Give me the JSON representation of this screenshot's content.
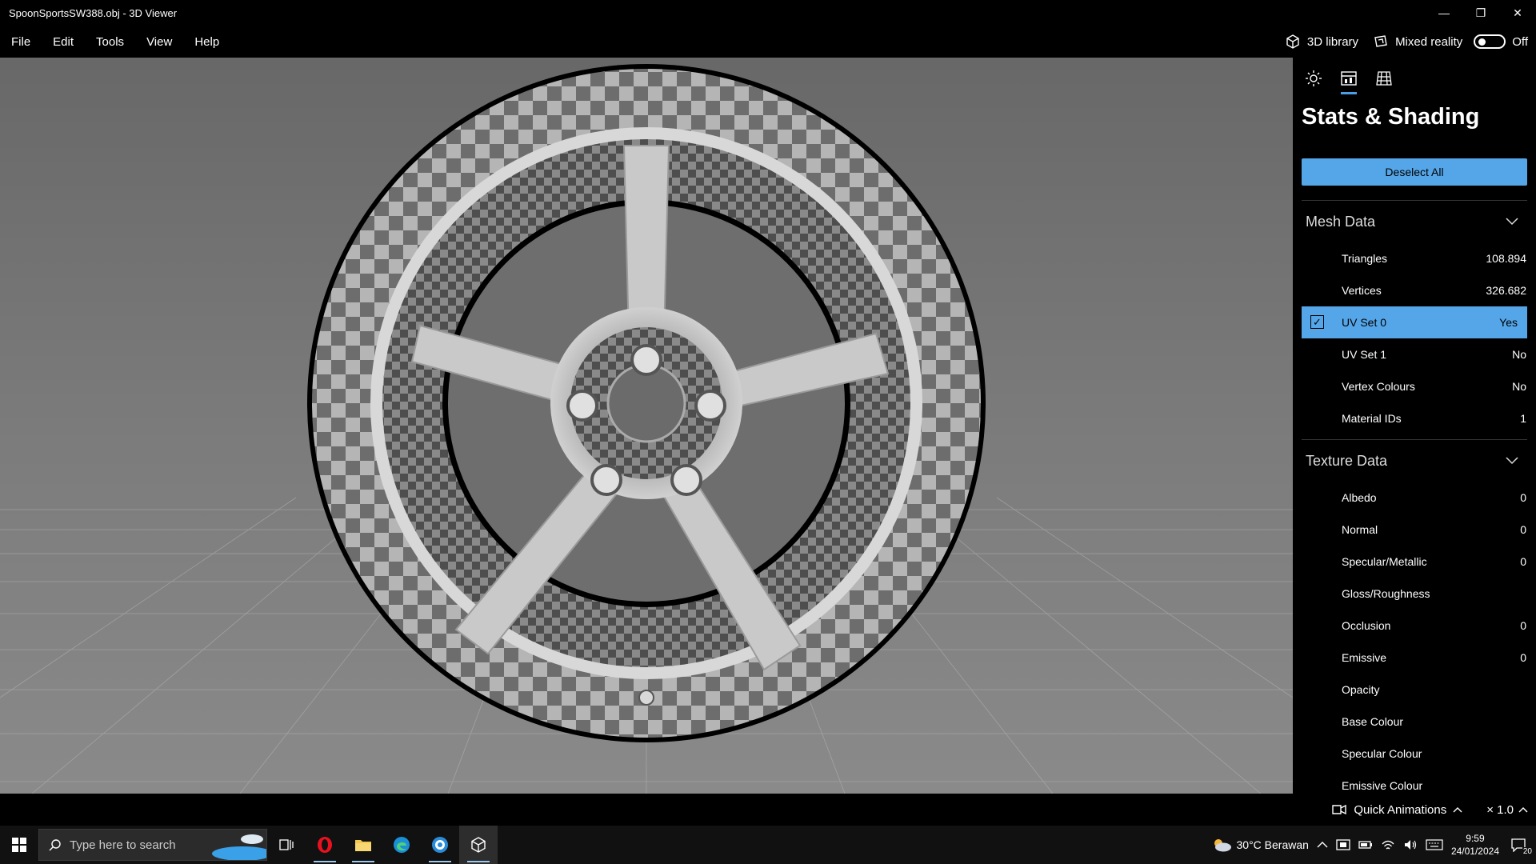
{
  "window": {
    "title": "SpoonSportsSW388.obj - 3D Viewer"
  },
  "menu": {
    "items": [
      "File",
      "Edit",
      "Tools",
      "View",
      "Help"
    ],
    "library_label": "3D library",
    "mixed_reality_label": "Mixed reality",
    "mixed_reality_state": "Off"
  },
  "panel": {
    "title": "Stats & Shading",
    "deselect_label": "Deselect All",
    "mesh_section": "Mesh Data",
    "mesh_rows": [
      {
        "label": "Triangles",
        "value": "108.894"
      },
      {
        "label": "Vertices",
        "value": "326.682"
      },
      {
        "label": "UV Set 0",
        "value": "Yes"
      },
      {
        "label": "UV Set 1",
        "value": "No"
      },
      {
        "label": "Vertex Colours",
        "value": "No"
      },
      {
        "label": "Material IDs",
        "value": "1"
      }
    ],
    "texture_section": "Texture Data",
    "texture_rows": [
      {
        "label": "Albedo",
        "value": "0"
      },
      {
        "label": "Normal",
        "value": "0"
      },
      {
        "label": "Specular/Metallic",
        "value": "0"
      },
      {
        "label": "Gloss/Roughness",
        "value": ""
      },
      {
        "label": "Occlusion",
        "value": "0"
      },
      {
        "label": "Emissive",
        "value": "0"
      },
      {
        "label": "Opacity",
        "value": ""
      },
      {
        "label": "Base Colour",
        "value": ""
      },
      {
        "label": "Specular Colour",
        "value": ""
      },
      {
        "label": "Emissive Colour",
        "value": ""
      }
    ],
    "accent_color": "#55a6e8"
  },
  "status": {
    "quick_animations": "Quick Animations",
    "speed": "× 1.0"
  },
  "taskbar": {
    "search_placeholder": "Type here to search",
    "weather": "30°C  Berawan",
    "time": "9:59",
    "date": "24/01/2024",
    "notifications": "20"
  }
}
